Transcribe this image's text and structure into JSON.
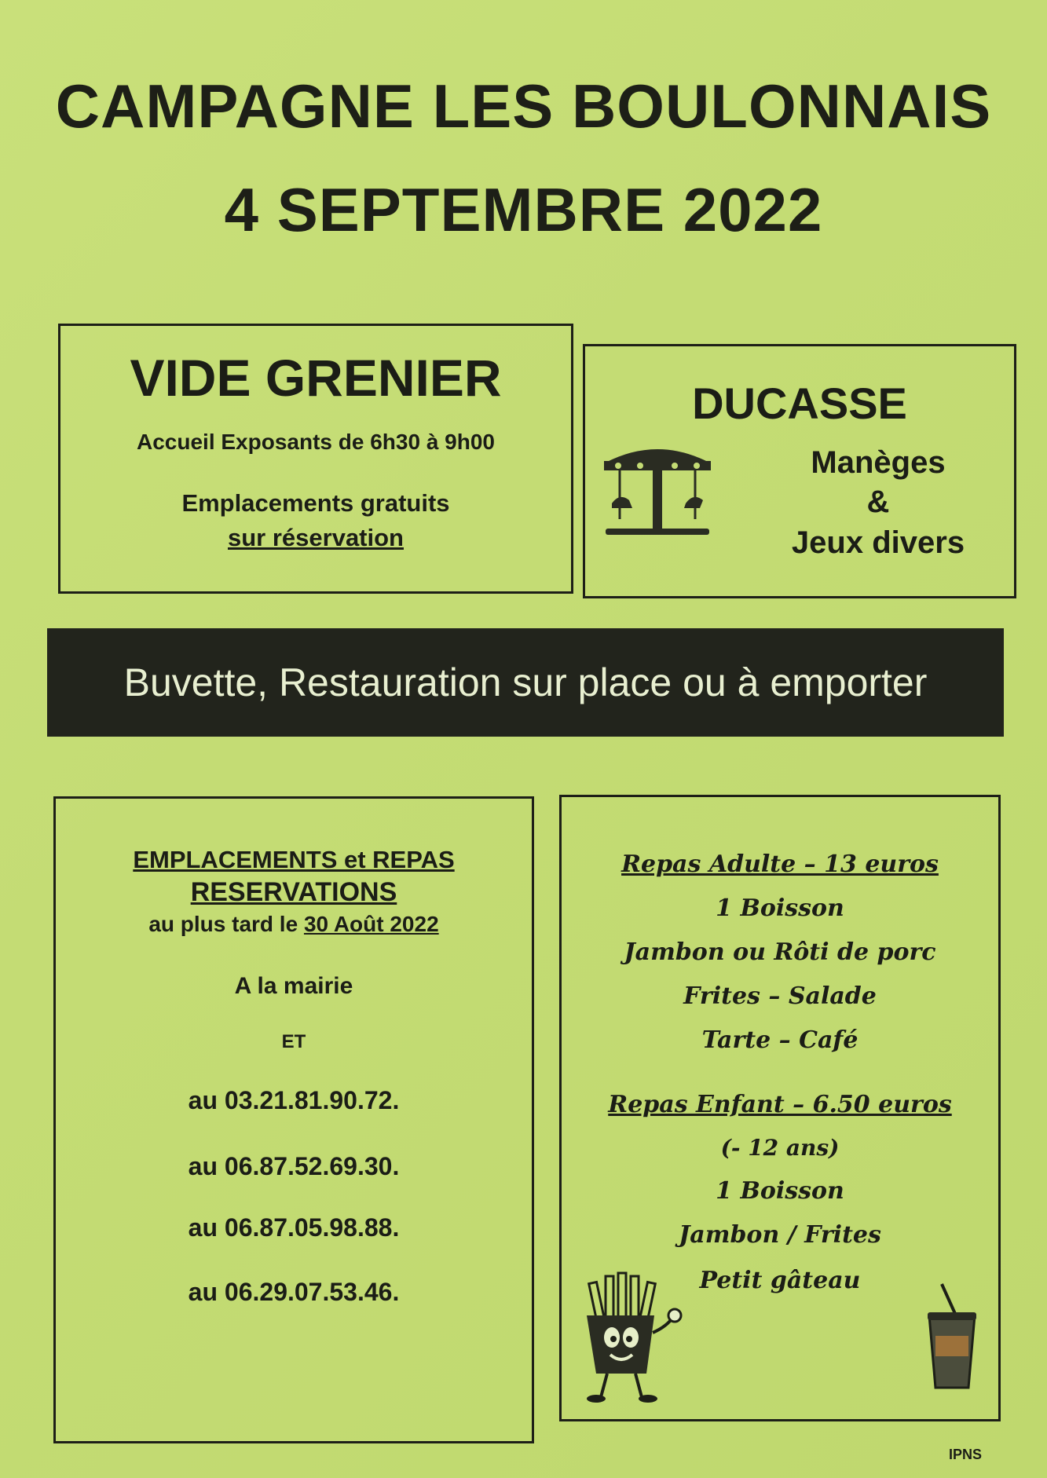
{
  "header": {
    "line1": "CAMPAGNE LES BOULONNAIS",
    "line2": "4 SEPTEMBRE 2022"
  },
  "vide_grenier": {
    "title": "VIDE GRENIER",
    "accueil": "Accueil Exposants de 6h30 à 9h00",
    "emplacements": "Emplacements gratuits",
    "reservation": "sur réservation"
  },
  "ducasse": {
    "title": "DUCASSE",
    "line1": "Manèges",
    "line2": "&",
    "line3": "Jeux divers",
    "icon": "carousel-icon"
  },
  "banner": {
    "text": "Buvette, Restauration sur place ou à emporter"
  },
  "reservations": {
    "heading1": "EMPLACEMENTS et REPAS",
    "heading2": "RESERVATIONS",
    "deadline_prefix": "au plus tard le ",
    "deadline_date": "30 Août 2022",
    "mairie": "A la mairie",
    "et": "ET",
    "phones": [
      "au 03.21.81.90.72.",
      "au 06.87.52.69.30.",
      "au 06.87.05.98.88.",
      "au 06.29.07.53.46."
    ]
  },
  "menu": {
    "adult_title": "Repas Adulte – 13 euros",
    "adult_items": [
      "1 Boisson",
      "Jambon ou Rôti de porc",
      "Frites – Salade",
      "Tarte – Café"
    ],
    "child_title": "Repas Enfant – 6.50 euros",
    "child_items": [
      "(- 12 ans)",
      "1 Boisson",
      "Jambon / Frites",
      "Petit gâteau"
    ],
    "icons": [
      "fries-mascot-icon",
      "drink-cup-icon"
    ]
  },
  "footer": {
    "ipns": "IPNS"
  }
}
